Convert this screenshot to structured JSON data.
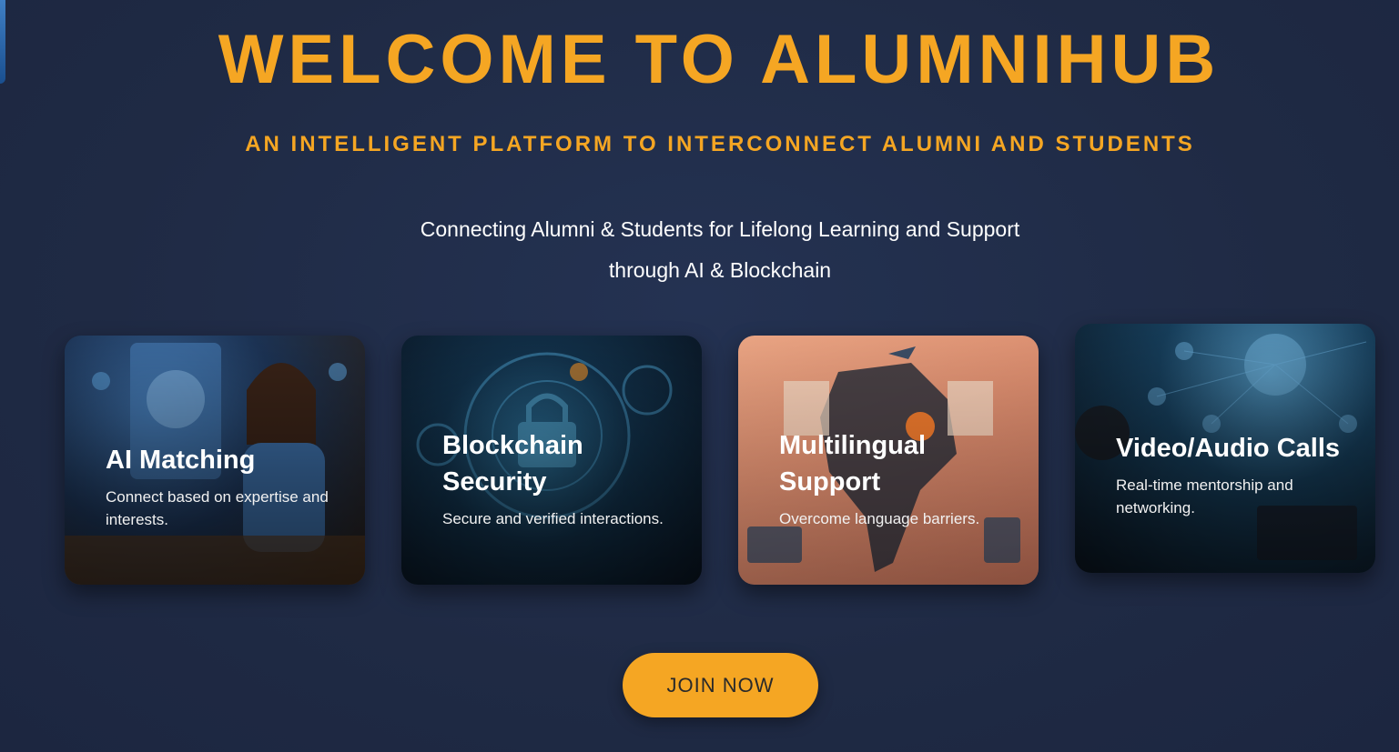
{
  "hero": {
    "title": "WELCOME TO ALUMNIHUB",
    "subtitle": "AN INTELLIGENT PLATFORM TO INTERCONNECT ALUMNI AND STUDENTS",
    "tagline_line1": "Connecting Alumni & Students for Lifelong Learning and Support",
    "tagline_line2": "through AI & Blockchain"
  },
  "features": [
    {
      "title": "AI Matching",
      "description": "Connect based on expertise and interests.",
      "image": "ai-matching-illustration"
    },
    {
      "title": "Blockchain Security",
      "description": "Secure and verified interactions.",
      "image": "blockchain-lock-illustration"
    },
    {
      "title": "Multilingual Support",
      "description": "Overcome language barriers.",
      "image": "india-map-illustration"
    },
    {
      "title": "Video/Audio Calls",
      "description": "Real-time mentorship and networking.",
      "image": "network-video-illustration"
    }
  ],
  "cta": {
    "join_label": "JOIN NOW"
  },
  "colors": {
    "accent": "#f5a623",
    "background": "#1f2a44",
    "text": "#ffffff"
  }
}
